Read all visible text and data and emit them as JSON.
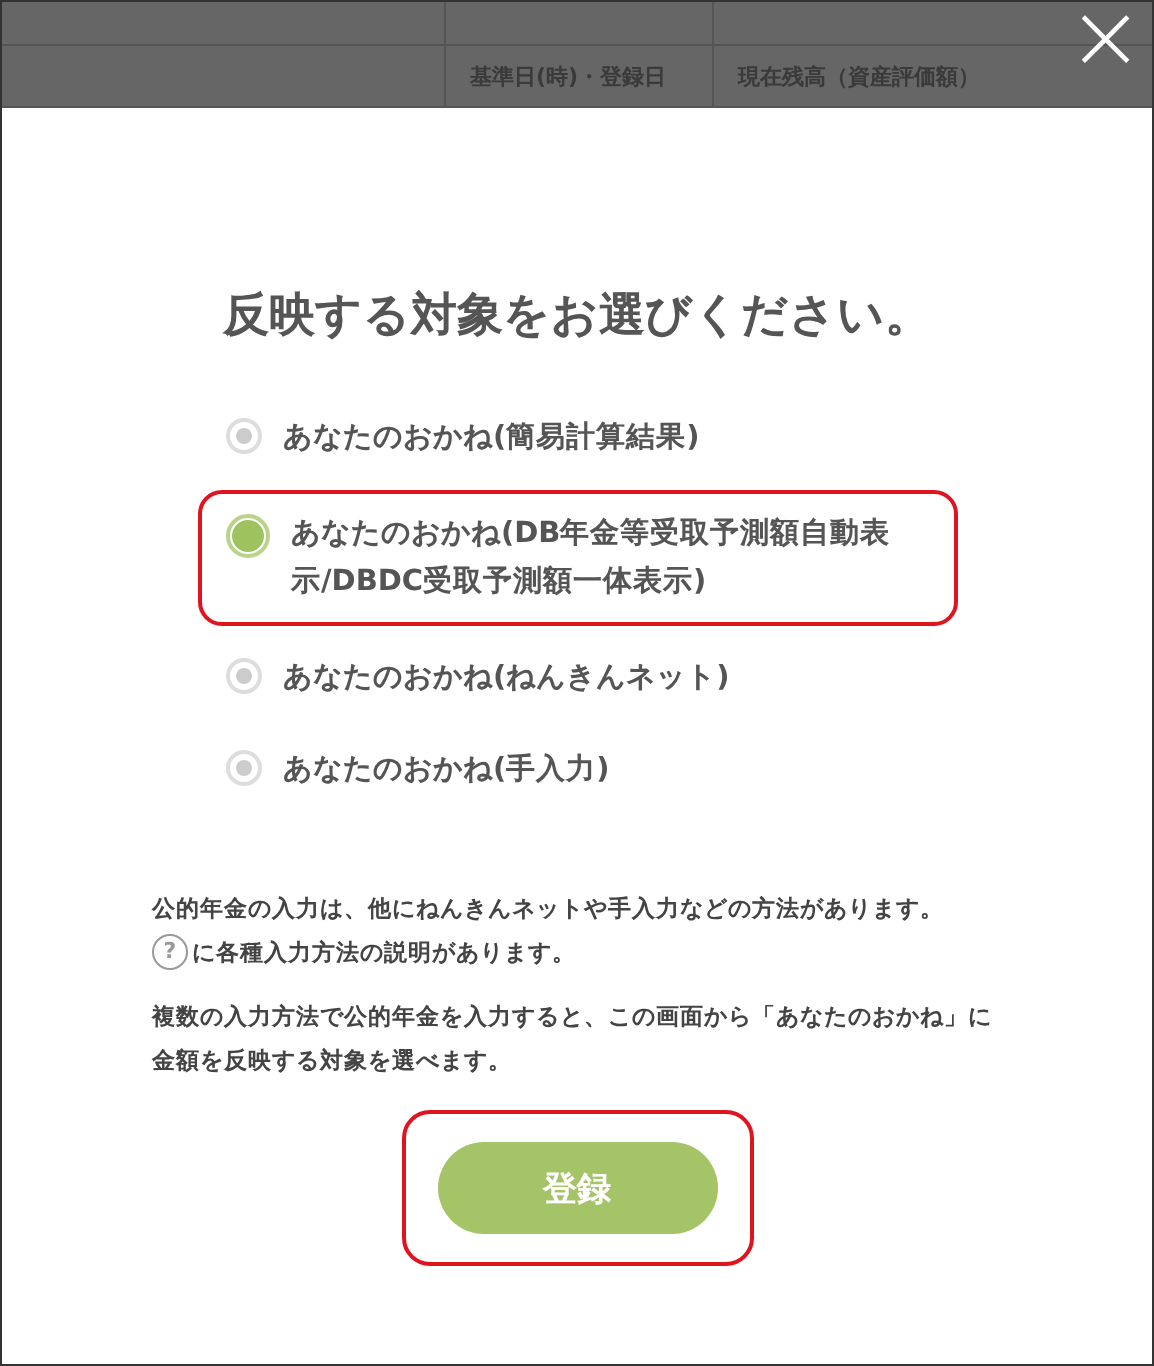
{
  "background_table": {
    "columns": [
      {},
      {
        "label": "基準日(時)・登録日"
      },
      {
        "label": "現在残高（資産評価額）"
      }
    ]
  },
  "close_button": {
    "label": "×"
  },
  "dialog": {
    "title": "反映する対象をお選びください。",
    "options": [
      {
        "label": "あなたのおかね(簡易計算結果)",
        "selected": false,
        "highlighted": false
      },
      {
        "label": "あなたのおかね(DB年金等受取予測額自動表示/DBDC受取予測額一体表示)",
        "selected": true,
        "highlighted": true
      },
      {
        "label": "あなたのおかね(ねんきんネット)",
        "selected": false,
        "highlighted": false
      },
      {
        "label": "あなたのおかね(手入力)",
        "selected": false,
        "highlighted": false
      }
    ],
    "note_1": "公的年金の入力は、他にねんきんネットや手入力などの方法があります。",
    "note_2": "に各種入力方法の説明があります。",
    "help_icon": "?",
    "note_3": "複数の入力方法で公的年金を入力すると、この画面から「あなたのおかね」に金額を反映する対象を選べます。",
    "submit": {
      "label": "登録",
      "highlighted": true
    }
  }
}
